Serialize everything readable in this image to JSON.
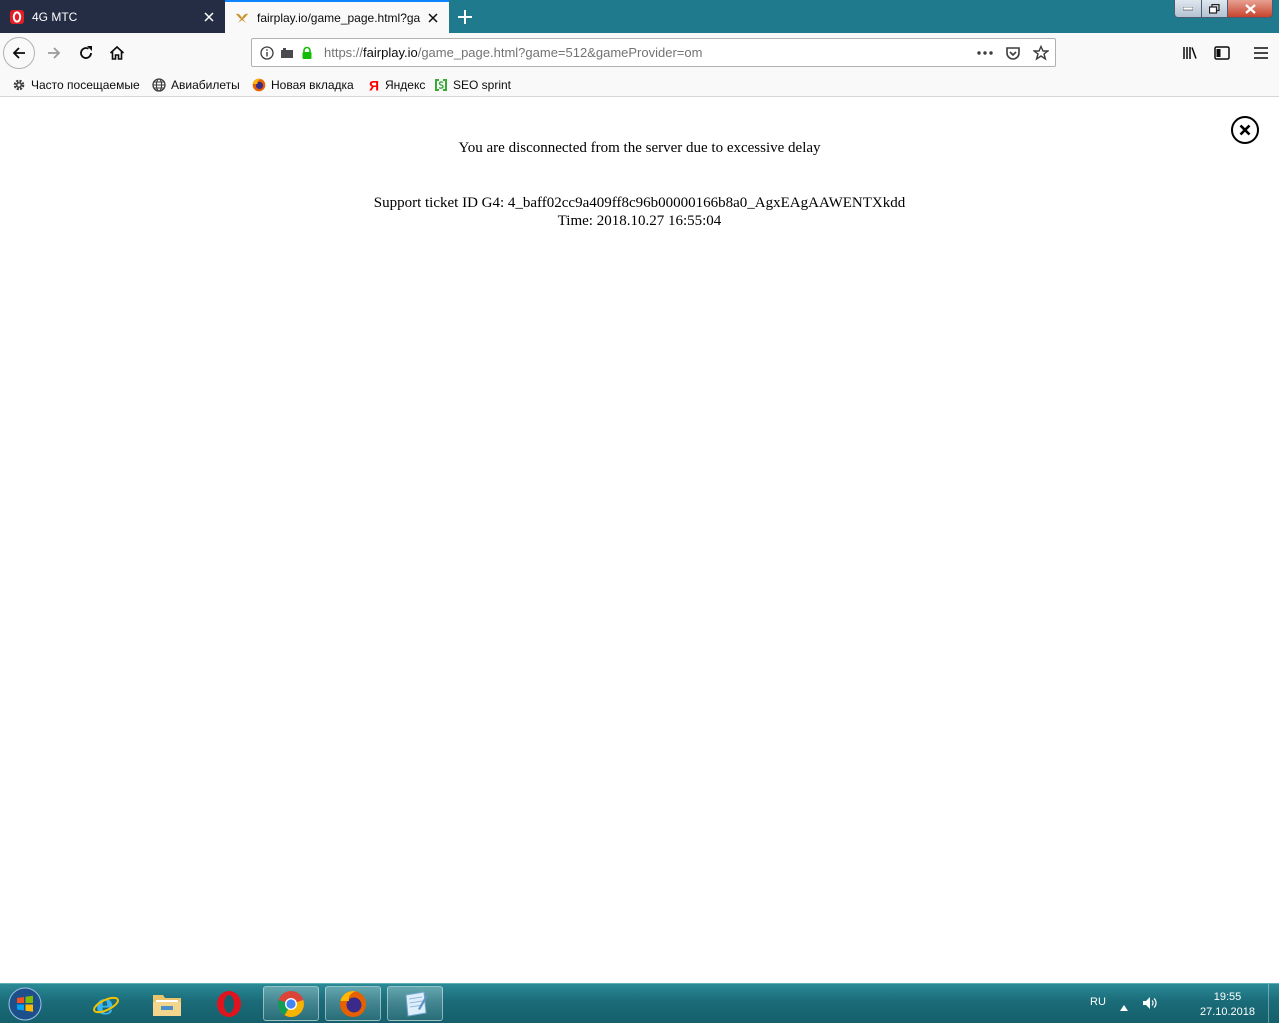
{
  "tabs": [
    {
      "label": "4G МТС",
      "active": false
    },
    {
      "label": "fairplay.io/game_page.html?ga",
      "active": true
    }
  ],
  "address_bar": {
    "scheme": "https://",
    "host": "fairplay.io",
    "path": "/game_page.html?game=512&gameProvider=om"
  },
  "bookmarks": [
    {
      "label": "Часто посещаемые",
      "icon": "gear-icon"
    },
    {
      "label": "Авиабилеты",
      "icon": "globe-icon"
    },
    {
      "label": "Новая вкладка",
      "icon": "firefox-icon"
    },
    {
      "label": "Яндекс",
      "icon": "yandex-icon"
    },
    {
      "label": "SEO sprint",
      "icon": "seo-sprint-icon"
    }
  ],
  "content": {
    "message": "You are disconnected from the server due to excessive delay",
    "ticket_line": "Support ticket ID G4: 4_baff02cc9a409ff8c96b00000166b8a0_AgxEAgAAWENTXkdd",
    "time_line": "Time: 2018.10.27 16:55:04"
  },
  "taskbar": {
    "apps": [
      "internet-explorer",
      "file-explorer",
      "opera",
      "chrome",
      "firefox",
      "notepad"
    ],
    "language": "RU",
    "time": "19:55",
    "date": "27.10.2018"
  },
  "colors": {
    "tab_strip": "#1e7a8c",
    "inactive_tab": "#242d44",
    "active_tab": "#f9f9fa",
    "lock_green": "#12bc00",
    "taskbar": "#1a6b78"
  }
}
